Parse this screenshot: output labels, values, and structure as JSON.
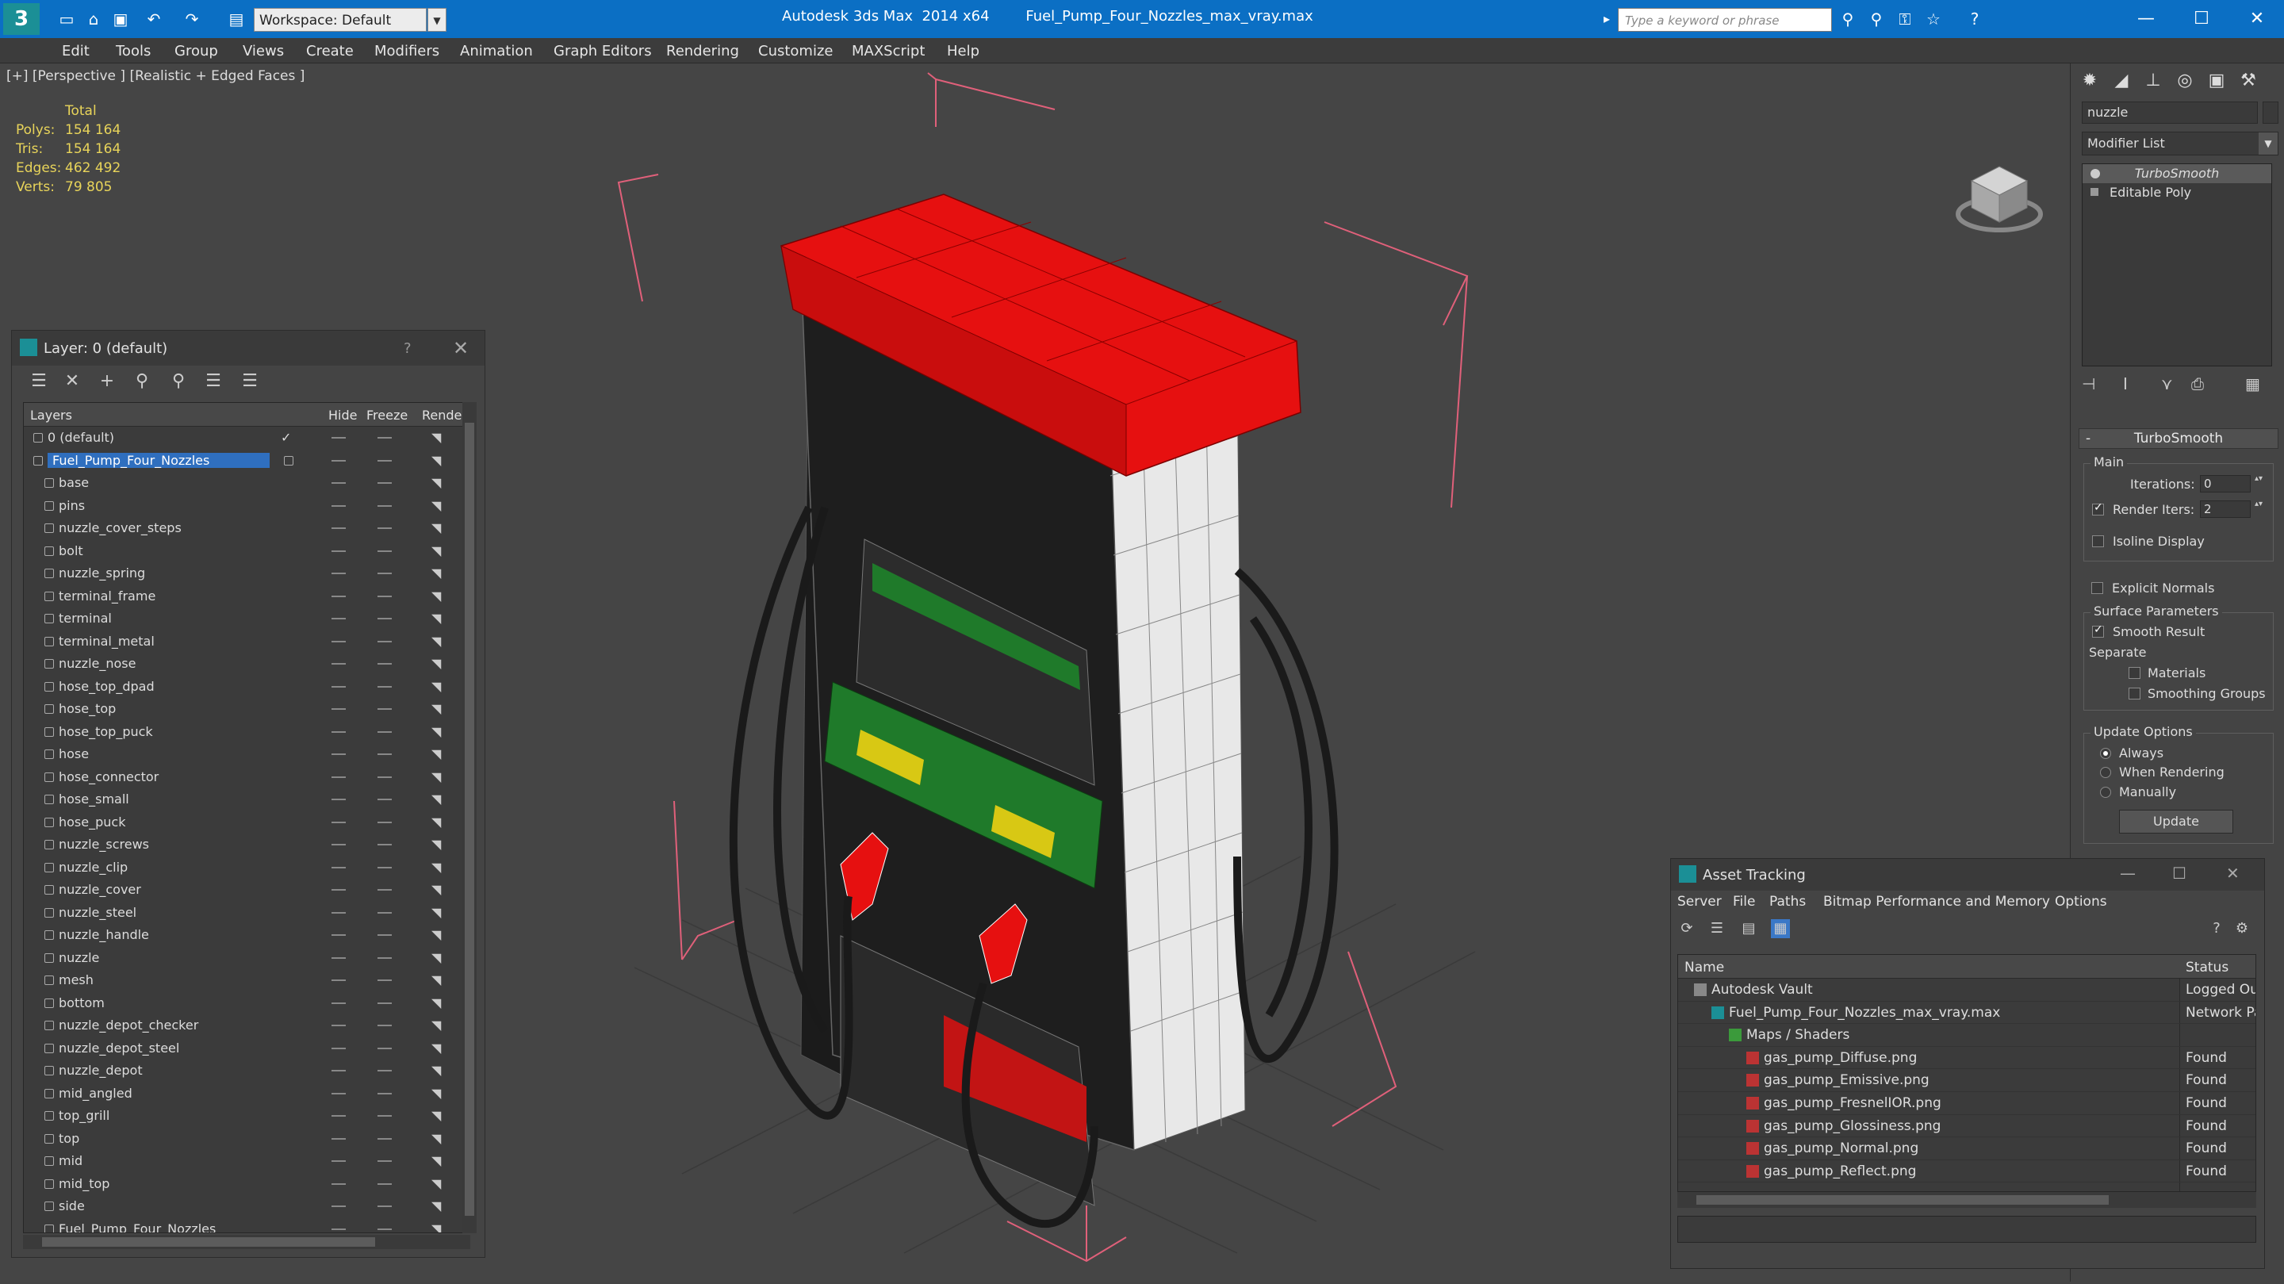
{
  "titlebar": {
    "logo": "3",
    "workspace": "Workspace: Default",
    "app": "Autodesk 3ds Max  2014 x64",
    "file": "Fuel_Pump_Four_Nozzles_max_vray.max",
    "search_placeholder": "Type a keyword or phrase",
    "min": "—",
    "max": "☐",
    "close": "✕"
  },
  "menu": [
    "Edit",
    "Tools",
    "Group",
    "Views",
    "Create",
    "Modifiers",
    "Animation",
    "Graph Editors",
    "Rendering",
    "Customize",
    "MAXScript",
    "Help"
  ],
  "viewport": {
    "label": "[+] [Perspective ] [Realistic + Edged Faces ]",
    "stats": {
      "header": "Total",
      "rows": [
        {
          "k": "Polys:",
          "v": "154 164"
        },
        {
          "k": "Tris:",
          "v": "154 164"
        },
        {
          "k": "Edges:",
          "v": "462 492"
        },
        {
          "k": "Verts:",
          "v": "79 805"
        }
      ]
    }
  },
  "layer_panel": {
    "title": "Layer: 0 (default)",
    "help": "?",
    "close": "✕",
    "columns": {
      "layers": "Layers",
      "hide": "Hide",
      "freeze": "Freeze",
      "render": "Render"
    },
    "rows": [
      {
        "name": "0 (default)",
        "level": 0
      },
      {
        "name": "Fuel_Pump_Four_Nozzles",
        "level": 0
      },
      {
        "name": "base",
        "level": 1
      },
      {
        "name": "pins",
        "level": 1
      },
      {
        "name": "nuzzle_cover_steps",
        "level": 1
      },
      {
        "name": "bolt",
        "level": 1
      },
      {
        "name": "nuzzle_spring",
        "level": 1
      },
      {
        "name": "terminal_frame",
        "level": 1
      },
      {
        "name": "terminal",
        "level": 1
      },
      {
        "name": "terminal_metal",
        "level": 1
      },
      {
        "name": "nuzzle_nose",
        "level": 1
      },
      {
        "name": "hose_top_dpad",
        "level": 1
      },
      {
        "name": "hose_top",
        "level": 1
      },
      {
        "name": "hose_top_puck",
        "level": 1
      },
      {
        "name": "hose",
        "level": 1
      },
      {
        "name": "hose_connector",
        "level": 1
      },
      {
        "name": "hose_small",
        "level": 1
      },
      {
        "name": "hose_puck",
        "level": 1
      },
      {
        "name": "nuzzle_screws",
        "level": 1
      },
      {
        "name": "nuzzle_clip",
        "level": 1
      },
      {
        "name": "nuzzle_cover",
        "level": 1
      },
      {
        "name": "nuzzle_steel",
        "level": 1
      },
      {
        "name": "nuzzle_handle",
        "level": 1
      },
      {
        "name": "nuzzle",
        "level": 1
      },
      {
        "name": "mesh",
        "level": 1
      },
      {
        "name": "bottom",
        "level": 1
      },
      {
        "name": "nuzzle_depot_checker",
        "level": 1
      },
      {
        "name": "nuzzle_depot_steel",
        "level": 1
      },
      {
        "name": "nuzzle_depot",
        "level": 1
      },
      {
        "name": "mid_angled",
        "level": 1
      },
      {
        "name": "top_grill",
        "level": 1
      },
      {
        "name": "top",
        "level": 1
      },
      {
        "name": "mid",
        "level": 1
      },
      {
        "name": "mid_top",
        "level": 1
      },
      {
        "name": "side",
        "level": 1
      },
      {
        "name": "Fuel_Pump_Four_Nozzles",
        "level": 1
      }
    ]
  },
  "command_panel": {
    "object_name": "nuzzle",
    "modifier_list": "Modifier List",
    "stack": [
      "TurboSmooth",
      "Editable Poly"
    ],
    "turbosmooth": {
      "title": "TurboSmooth",
      "collapse": "-",
      "main": "Main",
      "iterations_label": "Iterations:",
      "iterations": "0",
      "render_iters_label": "Render Iters:",
      "render_iters": "2",
      "isoline": "Isoline Display",
      "explicit": "Explicit Normals",
      "surface": "Surface Parameters",
      "smooth_result": "Smooth Result",
      "separate": "Separate",
      "materials": "Materials",
      "smoothing_groups": "Smoothing Groups",
      "update_options": "Update Options",
      "always": "Always",
      "when_rendering": "When Rendering",
      "manually": "Manually",
      "update": "Update"
    }
  },
  "asset_tracking": {
    "title": "Asset Tracking",
    "menu": [
      "Server",
      "File",
      "Paths",
      "Bitmap Performance and Memory",
      "Options"
    ],
    "columns": {
      "name": "Name",
      "status": "Status"
    },
    "rows": [
      {
        "name": "Autodesk Vault",
        "status": "Logged Out",
        "indent": 0
      },
      {
        "name": "Fuel_Pump_Four_Nozzles_max_vray.max",
        "status": "Network Pat",
        "indent": 1
      },
      {
        "name": "Maps / Shaders",
        "status": "",
        "indent": 2
      },
      {
        "name": "gas_pump_Diffuse.png",
        "status": "Found",
        "indent": 3
      },
      {
        "name": "gas_pump_Emissive.png",
        "status": "Found",
        "indent": 3
      },
      {
        "name": "gas_pump_FresnelIOR.png",
        "status": "Found",
        "indent": 3
      },
      {
        "name": "gas_pump_Glossiness.png",
        "status": "Found",
        "indent": 3
      },
      {
        "name": "gas_pump_Normal.png",
        "status": "Found",
        "indent": 3
      },
      {
        "name": "gas_pump_Reflect.png",
        "status": "Found",
        "indent": 3
      }
    ]
  },
  "colors": {
    "titlebar": "#0b6fc4",
    "selection": "#2f6fbf",
    "stats": "#e8d45a",
    "pump_red": "#e61010",
    "pump_green": "#1f7a2a",
    "pump_yellow": "#d8c814",
    "bbox_pink": "#e0607a"
  },
  "icons": [
    "app-logo-icon",
    "new-icon",
    "open-icon",
    "save-icon",
    "undo-icon",
    "redo-icon",
    "viewcube-icon",
    "search-icon",
    "help-icon"
  ]
}
